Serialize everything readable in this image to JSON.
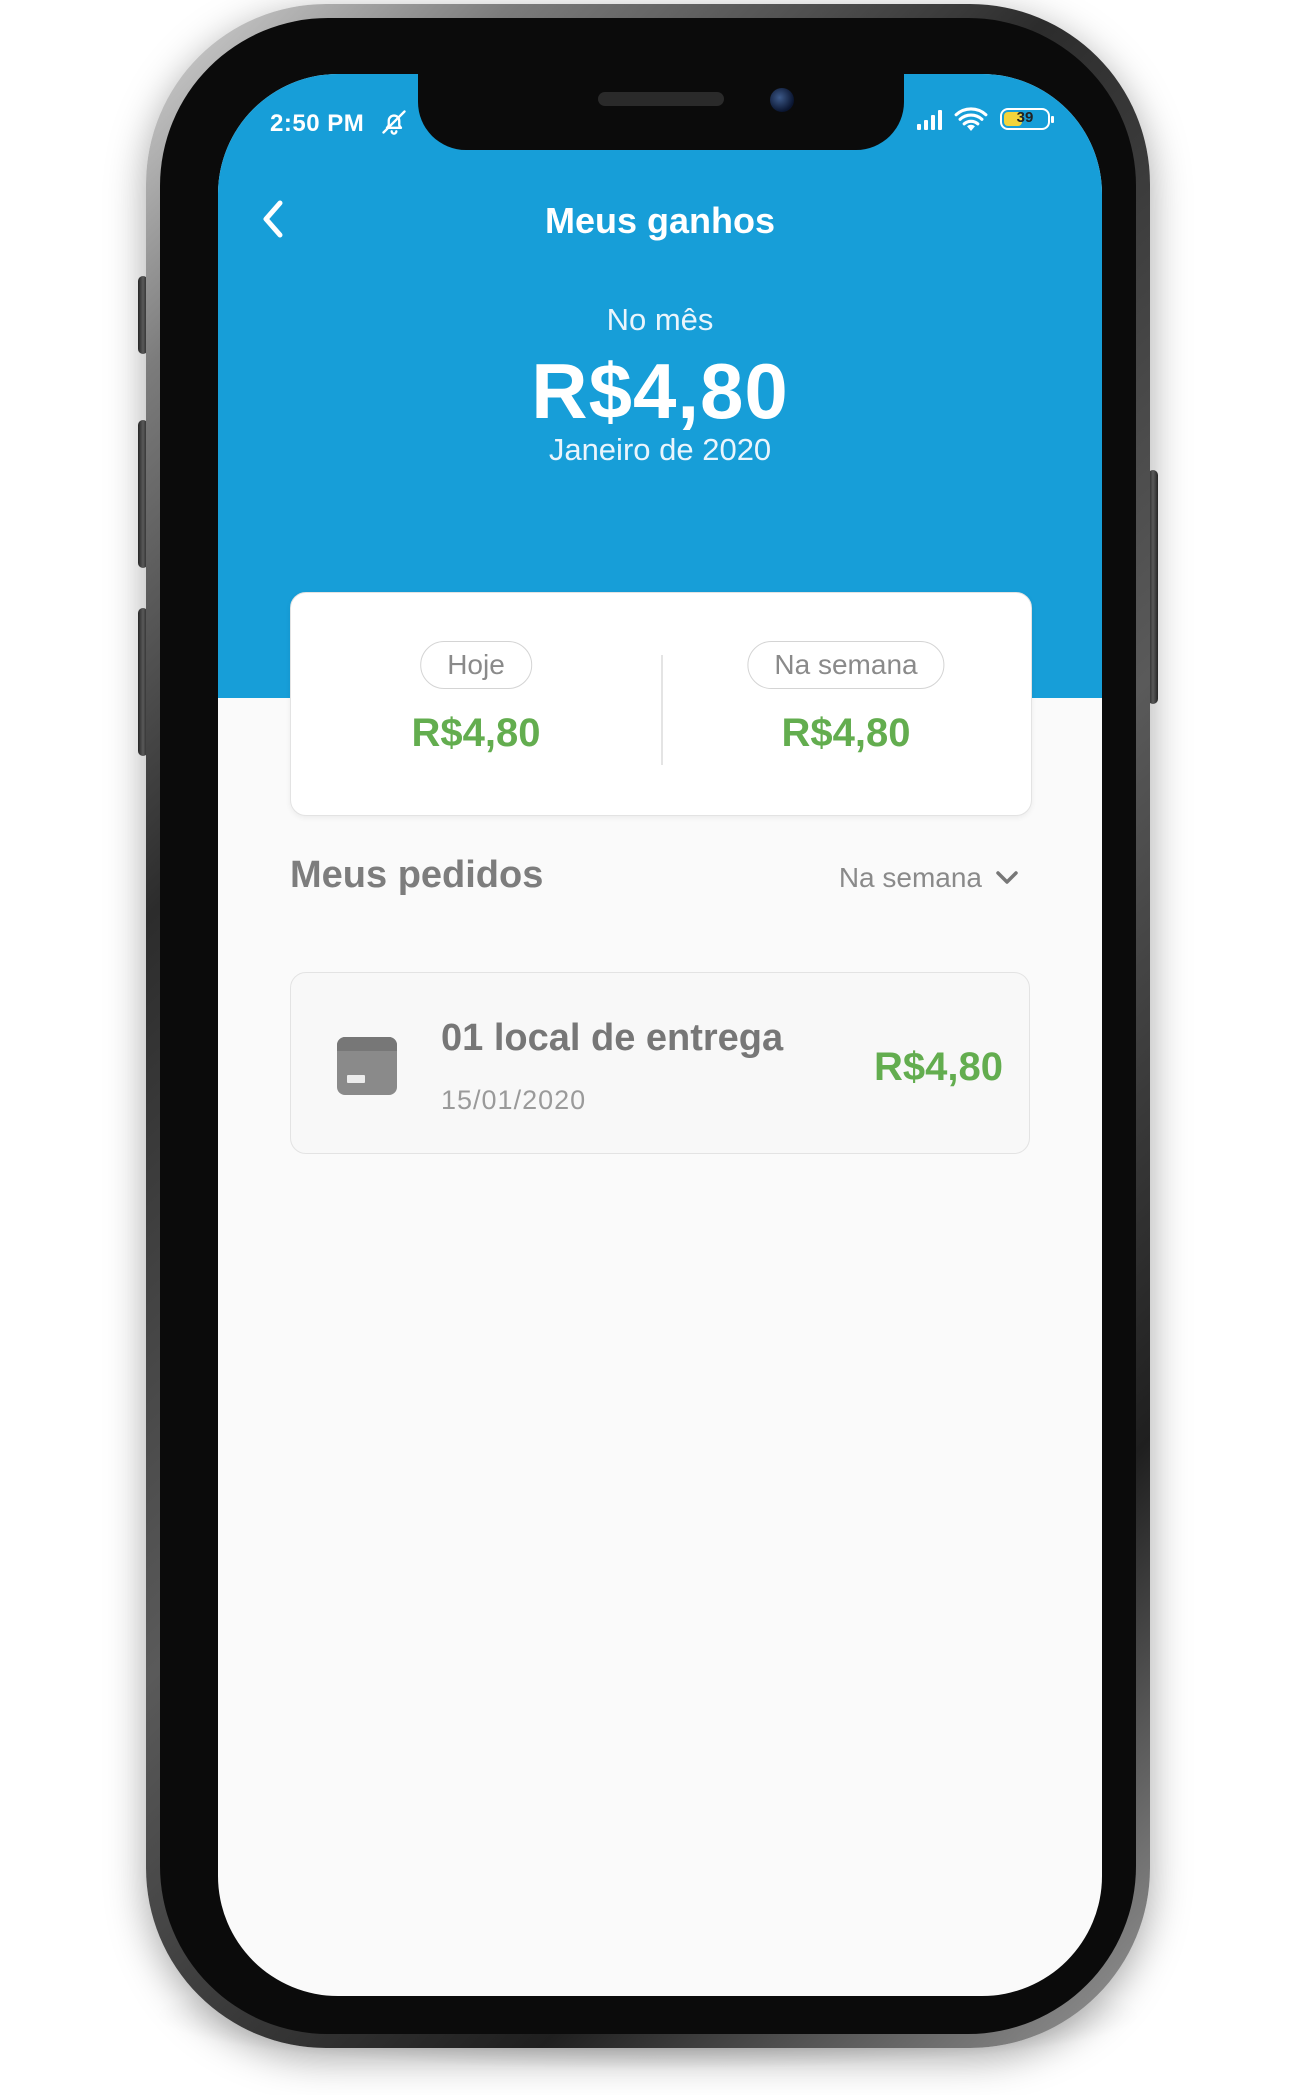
{
  "colors": {
    "brand": "#179ED8",
    "money": "#63AD4F"
  },
  "status_bar": {
    "time": "2:50 PM",
    "battery": "39",
    "icons": [
      "bell-off-icon",
      "signal-icon",
      "wifi-icon",
      "battery-icon"
    ]
  },
  "header": {
    "title": "Meus ganhos",
    "back_icon": "chevron-left-icon"
  },
  "month_summary": {
    "label": "No mês",
    "value": "R$4,80",
    "period": "Janeiro de 2020"
  },
  "summary_card": {
    "today": {
      "label": "Hoje",
      "value": "R$4,80"
    },
    "week": {
      "label": "Na semana",
      "value": "R$4,80"
    }
  },
  "orders_section": {
    "title": "Meus pedidos",
    "filter": {
      "selected": "Na semana",
      "icon": "chevron-down-icon"
    },
    "items": [
      {
        "title": "01 local de entrega",
        "date": "15/01/2020",
        "value": "R$4,80",
        "icon": "package-icon"
      }
    ]
  }
}
